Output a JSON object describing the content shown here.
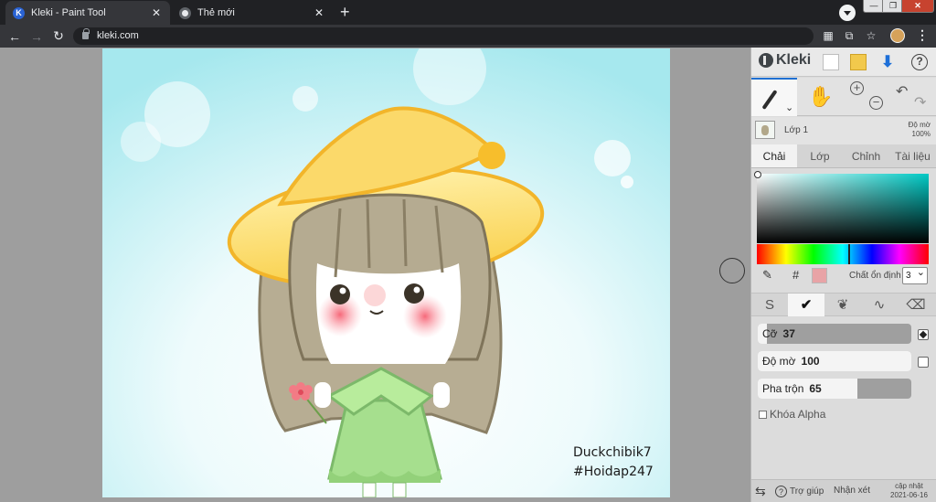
{
  "browser": {
    "tabs": [
      {
        "title": "Kleki - Paint Tool",
        "active": true
      },
      {
        "title": "Thẻ mới",
        "active": false
      }
    ],
    "new_tab_symbol": "+",
    "url": "kleki.com"
  },
  "artwork": {
    "watermark": [
      "Duckchibik7",
      "#Hoidap247"
    ]
  },
  "panel": {
    "app_name": "Kleki",
    "layer": {
      "name": "Lớp 1",
      "opacity_label": "Độ mờ",
      "opacity_value": "100%"
    },
    "tabs": [
      "Chải",
      "Lớp",
      "Chỉnh",
      "Tài liệu"
    ],
    "active_tab": "Chải",
    "color": {
      "hex_symbol": "#",
      "swatch": "#e8a3a6",
      "stabilizer_label": "Chất ổn định",
      "stabilizer_value": "3"
    },
    "sliders": {
      "size": {
        "label": "Cỡ",
        "value": 37,
        "level": 0.06
      },
      "opacity": {
        "label": "Độ mờ",
        "value": 100,
        "level": 1.0
      },
      "blend": {
        "label": "Pha trộn",
        "value": 65,
        "level": 0.65
      }
    },
    "alpha_lock": "Khóa Alpha",
    "footer": {
      "help": "Trợ giúp",
      "feedback": "Nhận xét",
      "update_line1": "cập nhật",
      "update_line2": "2021-06-16"
    }
  },
  "icons": [
    "kleki-favicon",
    "chrome-favicon",
    "back-icon",
    "forward-icon",
    "reload-icon",
    "lock-icon",
    "qr-icon",
    "translate-icon",
    "star-icon",
    "new-icon",
    "save-icon",
    "download-icon",
    "help-icon",
    "brush-icon",
    "hand-icon",
    "zoom-in-icon",
    "zoom-out-icon",
    "undo-icon",
    "redo-icon",
    "eyedropper-icon"
  ]
}
